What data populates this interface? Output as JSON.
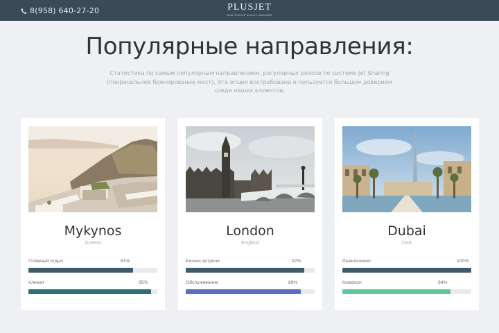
{
  "header": {
    "phone": "8(958) 640-27-20",
    "logo": "PLUSJET",
    "logo_tagline": "ВАШ ЛИЧНЫЙ БИЗНЕС-АВИАЦИЯ"
  },
  "section": {
    "title": "Популярные направления:",
    "subtitle": "Статистика по самым популярным направлениям, регулярных рейсов по системе Jet Sharing (покресельное бронирование мест). Эта опция востребована и пользуется большим доверием среди наших клиентов."
  },
  "destinations": [
    {
      "city": "Mykynos",
      "country": "Greece",
      "stats": [
        {
          "label": "Пляжный отдых",
          "percent": "81%",
          "value": 81,
          "color": "#3f5a6b"
        },
        {
          "label": "Климат",
          "percent": "95%",
          "value": 95,
          "color": "#2e6e78"
        }
      ]
    },
    {
      "city": "London",
      "country": "England",
      "stats": [
        {
          "label": "Бизнес встречи",
          "percent": "92%",
          "value": 92,
          "color": "#3f5a6b"
        },
        {
          "label": "Обслуживание",
          "percent": "89%",
          "value": 89,
          "color": "#5a6fc0"
        }
      ]
    },
    {
      "city": "Dubai",
      "country": "OAE",
      "stats": [
        {
          "label": "Развлечения",
          "percent": "100%",
          "value": 100,
          "color": "#3f5a6b"
        },
        {
          "label": "Комфорт",
          "percent": "84%",
          "value": 84,
          "color": "#5fc79a"
        }
      ]
    }
  ],
  "icons": {
    "phone": "phone-icon"
  }
}
